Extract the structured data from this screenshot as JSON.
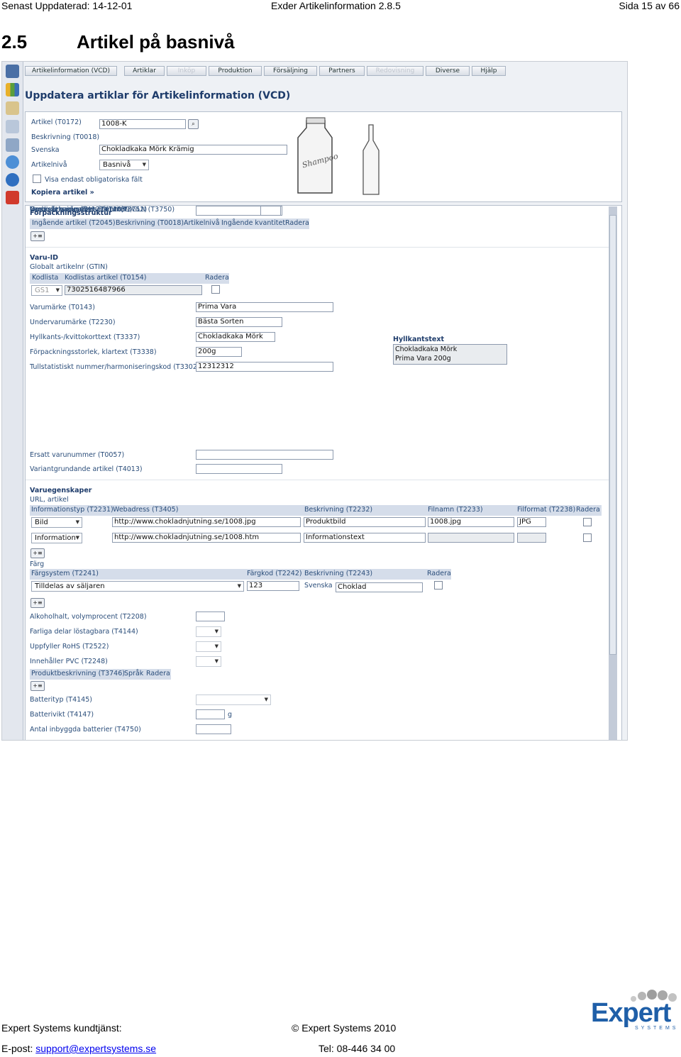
{
  "header": {
    "left": "Senast Uppdaterad: 14-12-01",
    "center": "Exder Artikelinformation 2.8.5",
    "right": "Sida 15 av 66"
  },
  "section": {
    "number": "2.5",
    "title": "Artikel på basnivå"
  },
  "app": {
    "tabs": [
      "Artikelinformation (VCD)",
      "Artiklar",
      "Inköp",
      "Produktion",
      "Försäljning",
      "Partners",
      "Redovisning",
      "Diverse",
      "Hjälp"
    ],
    "page_title": "Uppdatera artiklar för Artikelinformation (VCD)",
    "top": {
      "artikel_label": "Artikel (T0172)",
      "artikel_value": "1008-K",
      "beskrivning_label": "Beskrivning (T0018)",
      "svenska_label": "Svenska",
      "svenska_value": "Chokladkaka Mörk Krämig",
      "artikelniva_label": "Artikelnivå",
      "artikelniva_value": "Basnivå",
      "visa_label": "Visa endast obligatoriska fält",
      "kopiera_label": "Kopiera artikel »",
      "bottle_text": "Shampoo"
    },
    "forpack": {
      "title": "Förpackningsstruktur",
      "headers": [
        "Ingående artikel (T2045)",
        "Beskrivning (T0018)",
        "Artikelnivå",
        "Ingående kvantitet",
        "Radera"
      ]
    },
    "varuid": {
      "title": "Varu-ID",
      "gtin_label": "Globalt artikelnr (GTIN)",
      "headers": [
        "Kodlista",
        "Kodlistas artikel (T0154)",
        "Radera"
      ],
      "kodlista_value": "GS1",
      "gtin_value": "7302516487966",
      "fields": [
        {
          "label": "Varumärke (T0143)",
          "value": "Prima Vara"
        },
        {
          "label": "Undervarumärke (T2230)",
          "value": "Bästa Sorten"
        },
        {
          "label": "Hyllkants-/kvittokorttext (T3337)",
          "value": "Chokladkaka Mörk"
        },
        {
          "label": "Förpackningsstorlek, klartext (T3338)",
          "value": "200g"
        },
        {
          "label": "Tullstatistiskt nummer/harmoniseringskod (T3302)",
          "value": "12312312"
        },
        {
          "label": "Ersatt varunummer (T0057)",
          "value": ""
        },
        {
          "label": "Variantgrundande artikel (T4013)",
          "value": ""
        },
        {
          "label": "Nordiskt varunummer (T4039)",
          "value": ""
        },
        {
          "label": "Ombud, namn (T4127)",
          "value": ""
        },
        {
          "label": "Ombudets identitet (T4128)",
          "value": ""
        },
        {
          "label": "Varumärkesägarens namn (T3752)",
          "value": ""
        },
        {
          "label": "Varumärkesägarens identitet, GLN (T3750)",
          "value": ""
        }
      ],
      "hyllkant_title": "Hyllkantstext",
      "hyllkant_lines": [
        "Chokladkaka Mörk",
        "Prima Vara 200g"
      ]
    },
    "varuegen": {
      "title": "Varuegenskaper",
      "url_label": "URL, artikel",
      "headers": [
        "Informationstyp (T2231)",
        "Webadress (T3405)",
        "Beskrivning (T2232)",
        "Filnamn (T2233)",
        "Filformat (T2238)",
        "Radera"
      ],
      "rows": [
        {
          "typ": "Bild",
          "url": "http://www.chokladnjutning.se/1008.jpg",
          "beskr": "Produktbild",
          "fil": "1008.jpg",
          "format": "JPG"
        },
        {
          "typ": "Information",
          "url": "http://www.chokladnjutning.se/1008.htm",
          "beskr": "Informationstext",
          "fil": "",
          "format": ""
        }
      ],
      "farg_label": "Färg",
      "farg_headers": [
        "Färgsystem (T2241)",
        "Färgkod (T2242)",
        "Beskrivning (T2243)",
        "Radera"
      ],
      "fargsystem_value": "Tilldelas av säljaren",
      "fargkod_value": "123",
      "farg_lang": "Svenska",
      "farg_beskr": "Choklad",
      "extra_fields": [
        {
          "label": "Alkoholhalt, volymprocent (T2208)"
        },
        {
          "label": "Farliga delar löstagbara (T4144)"
        },
        {
          "label": "Uppfyller RoHS (T2522)"
        },
        {
          "label": "Innehåller PVC (T2248)"
        }
      ],
      "prod_headers": [
        "Produktbeskrivning (T3746)",
        "Språk",
        "Radera"
      ],
      "batt_fields": [
        {
          "label": "Batterityp (T4145)"
        },
        {
          "label": "Batterivikt (T4147)",
          "unit": "g"
        },
        {
          "label": "Antal inbyggda batterier (T4750)"
        }
      ]
    }
  },
  "footer": {
    "service": "Expert Systems kundtjänst:",
    "copyright": "© Expert Systems 2010",
    "email_label": "E-post: ",
    "email": "support@expertsystems.se",
    "phone": "Tel: 08-446 34 00",
    "logo_main": "Expert",
    "logo_sub": "SYSTEMS"
  },
  "colors": {
    "header_bar": "#d5ddea",
    "title": "#1e3c6b",
    "logo": "#1f5fa8"
  }
}
